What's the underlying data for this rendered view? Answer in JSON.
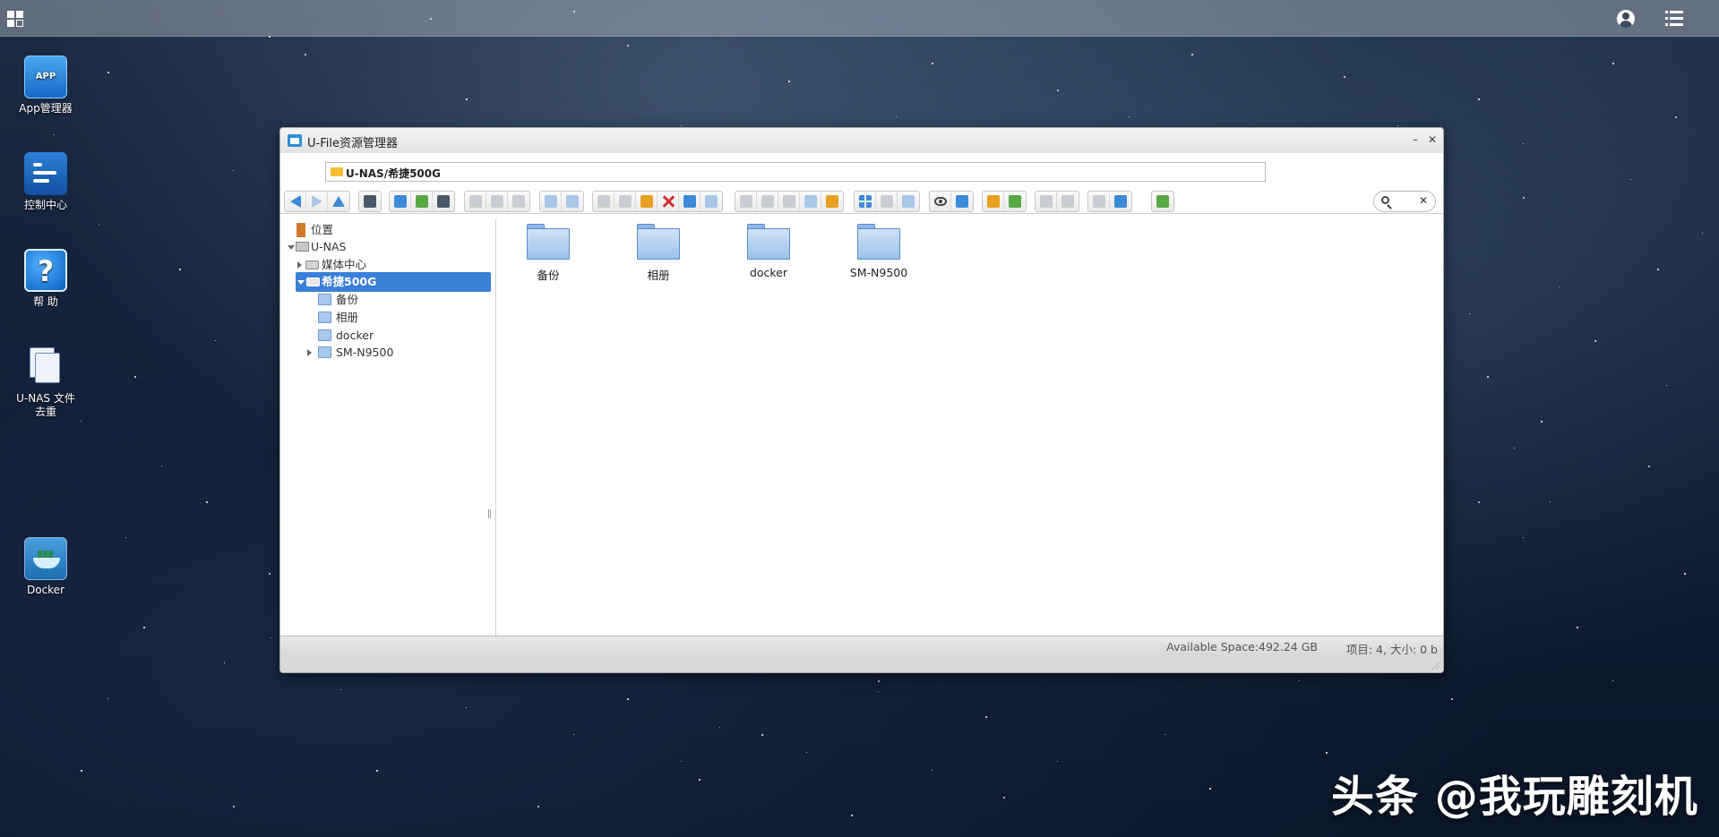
{
  "desktop": {
    "icons": [
      {
        "label": "App管理器",
        "icon": "app-store-icon"
      },
      {
        "label": "控制中心",
        "icon": "control-center-icon"
      },
      {
        "label": "帮 助",
        "icon": "help-icon"
      },
      {
        "label": "U-NAS 文件去重",
        "icon": "file-dedup-icon"
      },
      {
        "label": "Docker",
        "icon": "docker-icon"
      }
    ]
  },
  "window": {
    "title": "U-File资源管理器",
    "minimize_label": "–",
    "close_label": "✕",
    "address": "U-NAS/希捷500G"
  },
  "tree": {
    "items": [
      {
        "label": "位置",
        "icon": "location-icon"
      },
      {
        "label": "U-NAS",
        "icon": "computer-icon",
        "expanded": true
      },
      {
        "label": "媒体中心",
        "icon": "drive-icon",
        "expanded": false
      },
      {
        "label": "希捷500G",
        "icon": "drive-icon",
        "expanded": true,
        "selected": true
      },
      {
        "label": "备份",
        "icon": "folder-icon"
      },
      {
        "label": "相册",
        "icon": "folder-icon"
      },
      {
        "label": "docker",
        "icon": "folder-icon"
      },
      {
        "label": "SM-N9500",
        "icon": "folder-icon",
        "expanded": false
      }
    ]
  },
  "files": [
    {
      "name": "备份"
    },
    {
      "name": "相册"
    },
    {
      "name": "docker"
    },
    {
      "name": "SM-N9500"
    }
  ],
  "status": {
    "available_space": "Available Space:492.24 GB",
    "items_info": "项目: 4, 大小: 0 b"
  },
  "watermark": "头条 @我玩雕刻机",
  "colors": {
    "selection": "#3a7fd8",
    "folder": "#9cc3ec"
  }
}
